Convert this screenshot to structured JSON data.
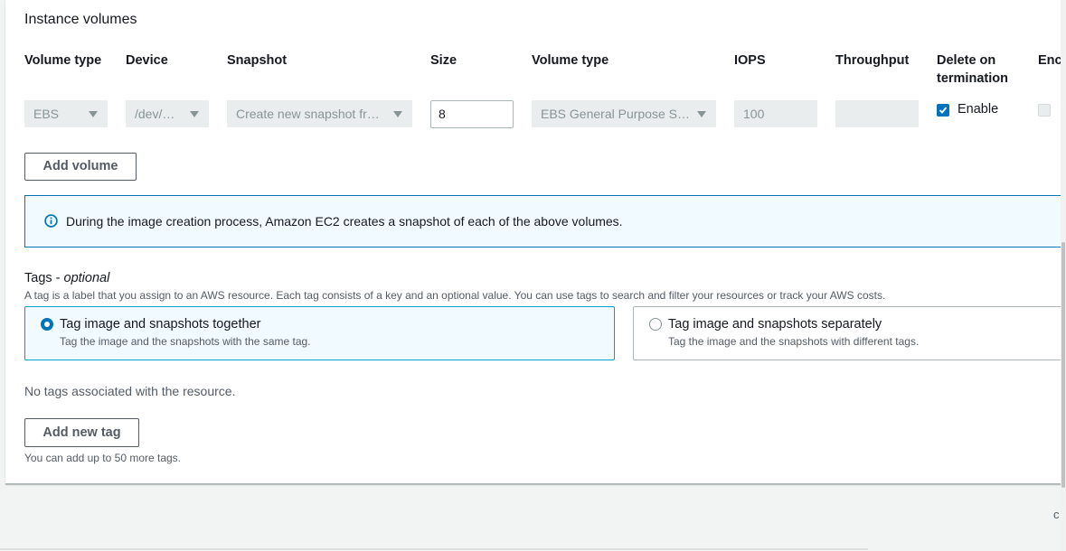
{
  "section": {
    "title": "Instance volumes"
  },
  "columns": {
    "volume_type": "Volume type",
    "device": "Device",
    "snapshot": "Snapshot",
    "size": "Size",
    "volume_type2": "Volume type",
    "iops": "IOPS",
    "throughput": "Throughput",
    "delete_line1": "Delete on",
    "delete_line2": "termination",
    "encrypted_partial": "Enc"
  },
  "row": {
    "volume_type": "EBS",
    "device": "/dev/…",
    "snapshot": "Create new snapshot fr…",
    "size": "8",
    "ebs_type": "EBS General Purpose S…",
    "iops": "100",
    "throughput": "",
    "delete_label": "Enable",
    "delete_checked": true,
    "encrypted_checked": false
  },
  "buttons": {
    "add_volume": "Add volume",
    "add_tag": "Add new tag"
  },
  "alert": {
    "text": "During the image creation process, Amazon EC2 creates a snapshot of each of the above volumes."
  },
  "tags": {
    "title": "Tags - ",
    "title_optional": "optional",
    "description": "A tag is a label that you assign to an AWS resource. Each tag consists of a key and an optional value. You can use tags to search and filter your resources or track your AWS costs.",
    "option_together": {
      "label": "Tag image and snapshots together",
      "desc": "Tag the image and the snapshots with the same tag.",
      "selected": true
    },
    "option_separate": {
      "label": "Tag image and snapshots separately",
      "desc": "Tag the image and the snapshots with different tags.",
      "selected": false
    },
    "empty": "No tags associated with the resource.",
    "limit_hint": "You can add up to 50 more tags."
  },
  "colors": {
    "accent": "#0073bb",
    "alert_bg": "#f1faff",
    "tile_border": "#00a1c9"
  }
}
